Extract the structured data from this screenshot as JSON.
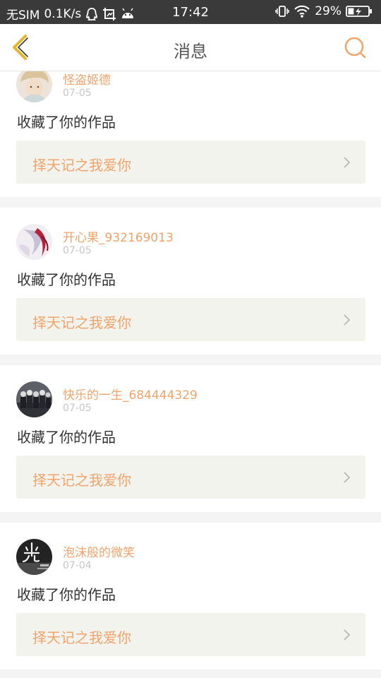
{
  "status_bar": {
    "carrier": "无SIM",
    "speed": "0.1K/s",
    "time": "17:42",
    "battery": "29%",
    "battery_level": 0.29,
    "icons": [
      "qq-icon",
      "screenshot-icon",
      "android-icon",
      "vibrate-icon",
      "wifi-icon",
      "battery-icon"
    ]
  },
  "nav": {
    "title": "消息",
    "back_icon": "chevron-left-icon",
    "search_icon": "search-icon"
  },
  "colors": {
    "accent": "#f0a36b",
    "back_arrow": "#e4b52e",
    "status_bar_bg": "#3a3a3a",
    "link_bg": "#f3f3ed"
  },
  "notifications": [
    {
      "username": "怪盗姬德",
      "date": "07-05",
      "action": "收藏了你的作品",
      "work_title": "择天记之我爱你"
    },
    {
      "username": "开心果_932169013",
      "date": "07-05",
      "action": "收藏了你的作品",
      "work_title": "择天记之我爱你"
    },
    {
      "username": "快乐的一生_684444329",
      "date": "07-05",
      "action": "收藏了你的作品",
      "work_title": "择天记之我爱你"
    },
    {
      "username": "泡沫般的微笑",
      "date": "07-04",
      "action": "收藏了你的作品",
      "work_title": "择天记之我爱你"
    }
  ]
}
